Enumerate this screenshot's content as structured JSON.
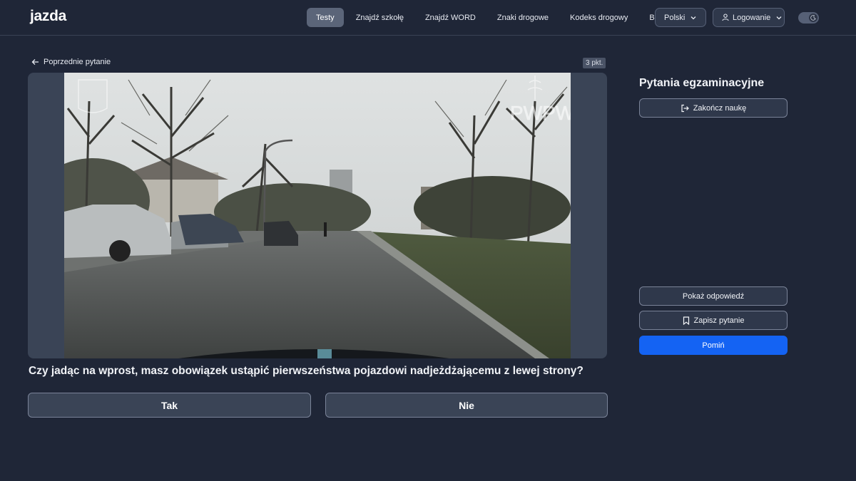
{
  "header": {
    "logo": "jazda",
    "nav": [
      {
        "label": "Testy",
        "active": true
      },
      {
        "label": "Znajdź szkołę",
        "active": false
      },
      {
        "label": "Znajdź WORD",
        "active": false
      },
      {
        "label": "Znaki drogowe",
        "active": false
      },
      {
        "label": "Kodeks drogowy",
        "active": false
      },
      {
        "label": "Blog",
        "active": false
      }
    ],
    "language": "Polski",
    "login": "Logowanie"
  },
  "main": {
    "prev_label": "Poprzednie pytanie",
    "points": "3 pkt.",
    "watermark": "PWPW",
    "question": "Czy jadąc na wprost, masz obowiązek ustąpić pierwszeństwa pojazdowi nadjeżdżającemu z lewej strony?",
    "answers": {
      "yes": "Tak",
      "no": "Nie"
    }
  },
  "sidebar": {
    "title": "Pytania egzaminacyjne",
    "finish": "Zakończ naukę",
    "show_answer": "Pokaż odpowiedź",
    "save": "Zapisz pytanie",
    "skip": "Pomiń"
  },
  "colors": {
    "background": "#1f2637",
    "accent": "#1463f3",
    "nav_active": "#5b6579"
  }
}
